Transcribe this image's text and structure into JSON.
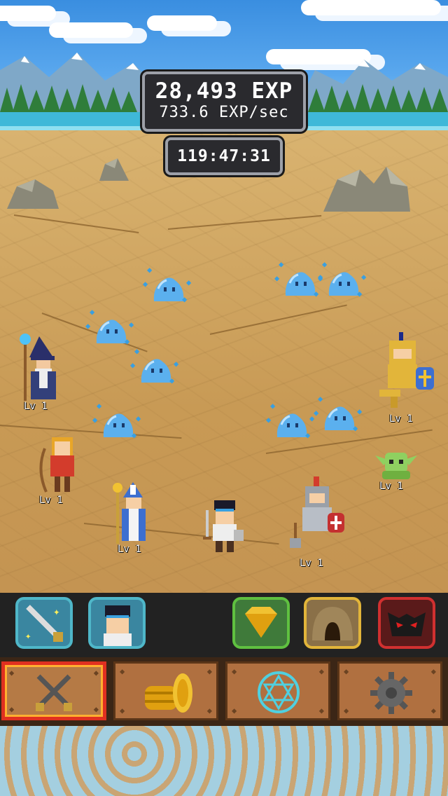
{
  "hud": {
    "exp_total": "28,493 EXP",
    "exp_rate": "733.6 EXP/sec",
    "timer": "119:47:31"
  },
  "heroes": [
    {
      "name": "wizard",
      "level": "Lv 1"
    },
    {
      "name": "archer",
      "level": "Lv 1"
    },
    {
      "name": "priest",
      "level": "Lv 1"
    },
    {
      "name": "hero",
      "level": ""
    },
    {
      "name": "knight",
      "level": "Lv 1"
    },
    {
      "name": "paladin",
      "level": "Lv 1"
    },
    {
      "name": "goblin",
      "level": "Lv 1"
    }
  ],
  "skill_buttons": [
    {
      "id": "sword-skill",
      "icon": "sparkle-sword-icon",
      "border": "#4fb7c9"
    },
    {
      "id": "hero-skill",
      "icon": "hero-portrait-icon",
      "border": "#4fb7c9"
    },
    {
      "id": "gem-shop",
      "icon": "gem-icon",
      "border": "#5fc040"
    },
    {
      "id": "cave",
      "icon": "cave-icon",
      "border": "#e2b53a"
    },
    {
      "id": "boss",
      "icon": "demon-icon",
      "border": "#d03030"
    }
  ],
  "tabs": [
    {
      "id": "battle",
      "icon": "crossed-swords-icon",
      "active": true
    },
    {
      "id": "gold",
      "icon": "gold-coins-icon",
      "active": false
    },
    {
      "id": "magic",
      "icon": "hexagram-icon",
      "active": false
    },
    {
      "id": "settings",
      "icon": "gear-icon",
      "active": false
    }
  ],
  "colors": {
    "slime": "#5bb0ee",
    "panel_bg": "#2a2a2e",
    "active_tab_border": "#e03020"
  }
}
